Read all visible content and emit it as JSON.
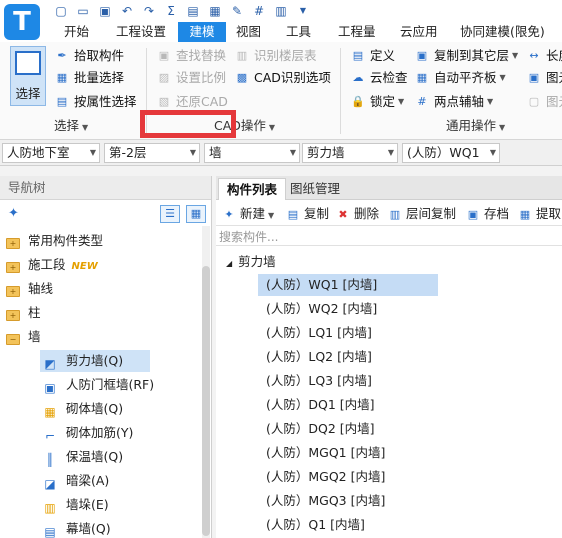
{
  "app": {
    "logo": "T"
  },
  "menu": [
    {
      "label": "开始",
      "active": false
    },
    {
      "label": "工程设置",
      "active": false
    },
    {
      "label": "建模",
      "active": true
    },
    {
      "label": "视图",
      "active": false
    },
    {
      "label": "工具",
      "active": false
    },
    {
      "label": "工程量",
      "active": false
    },
    {
      "label": "云应用",
      "active": false
    },
    {
      "label": "协同建模(限免)",
      "active": false
    }
  ],
  "ribbon": {
    "select_label": "选择",
    "pick_component": "拾取构件",
    "batch_select": "批量选择",
    "select_by_attr": "按属性选择",
    "find_replace": "查找替换",
    "set_scale": "设置比例",
    "restore_cad": "还原CAD",
    "recognize_floor_table": "识别楼层表",
    "cad_recognize_options": "CAD识别选项",
    "define": "定义",
    "cloud_check": "云检查",
    "lock": "锁定",
    "copy_to_other_floor": "复制到其它层",
    "auto_flat_slab": "自动平齐板",
    "two_point_aux": "两点辅轴",
    "length": "长度",
    "image1": "图元",
    "image2": "图元",
    "group_select": "选择",
    "group_cad": "CAD操作",
    "group_common": "通用操作"
  },
  "filters": [
    "人防地下室",
    "第-2层",
    "墙",
    "剪力墙",
    "(人防）WQ1"
  ],
  "nav": {
    "title": "导航树",
    "items": [
      {
        "label": "常用构件类型",
        "type": "folder",
        "new": false,
        "selected": false
      },
      {
        "label": "施工段",
        "type": "folder",
        "new": true,
        "selected": false
      },
      {
        "label": "轴线",
        "type": "folder",
        "new": false,
        "selected": false
      },
      {
        "label": "柱",
        "type": "folder",
        "new": false,
        "selected": false
      },
      {
        "label": "墙",
        "type": "folder-open",
        "new": false,
        "selected": false
      },
      {
        "label": "剪力墙(Q)",
        "type": "child",
        "icon": "shear-wall",
        "selected": true
      },
      {
        "label": "人防门框墙(RF)",
        "type": "child",
        "icon": "door-frame-wall",
        "selected": false
      },
      {
        "label": "砌体墙(Q)",
        "type": "child",
        "icon": "masonry-wall",
        "selected": false
      },
      {
        "label": "砌体加筋(Y)",
        "type": "child",
        "icon": "masonry-rebar",
        "selected": false
      },
      {
        "label": "保温墙(Q)",
        "type": "child",
        "icon": "insulation-wall",
        "selected": false
      },
      {
        "label": "暗梁(A)",
        "type": "child",
        "icon": "hidden-beam",
        "selected": false
      },
      {
        "label": "墙垛(E)",
        "type": "child",
        "icon": "wall-pier",
        "selected": false
      },
      {
        "label": "幕墙(Q)",
        "type": "child",
        "icon": "curtain-wall",
        "selected": false
      }
    ],
    "new_badge": "NEW"
  },
  "panel": {
    "tabs": [
      "构件列表",
      "图纸管理"
    ],
    "toolbar": [
      "新建",
      "复制",
      "删除",
      "层间复制",
      "存档",
      "提取"
    ],
    "search_placeholder": "搜索构件...",
    "root": "剪力墙",
    "components": [
      "(人防）WQ1 [内墙]",
      "(人防）WQ2 [内墙]",
      "(人防）LQ1 [内墙]",
      "(人防）LQ2 [内墙]",
      "(人防）LQ3 [内墙]",
      "(人防）DQ1 [内墙]",
      "(人防）DQ2 [内墙]",
      "(人防）MGQ1 [内墙]",
      "(人防）MGQ2 [内墙]",
      "(人防）MGQ3 [内墙]",
      "(人防）Q1 [内墙]"
    ]
  }
}
